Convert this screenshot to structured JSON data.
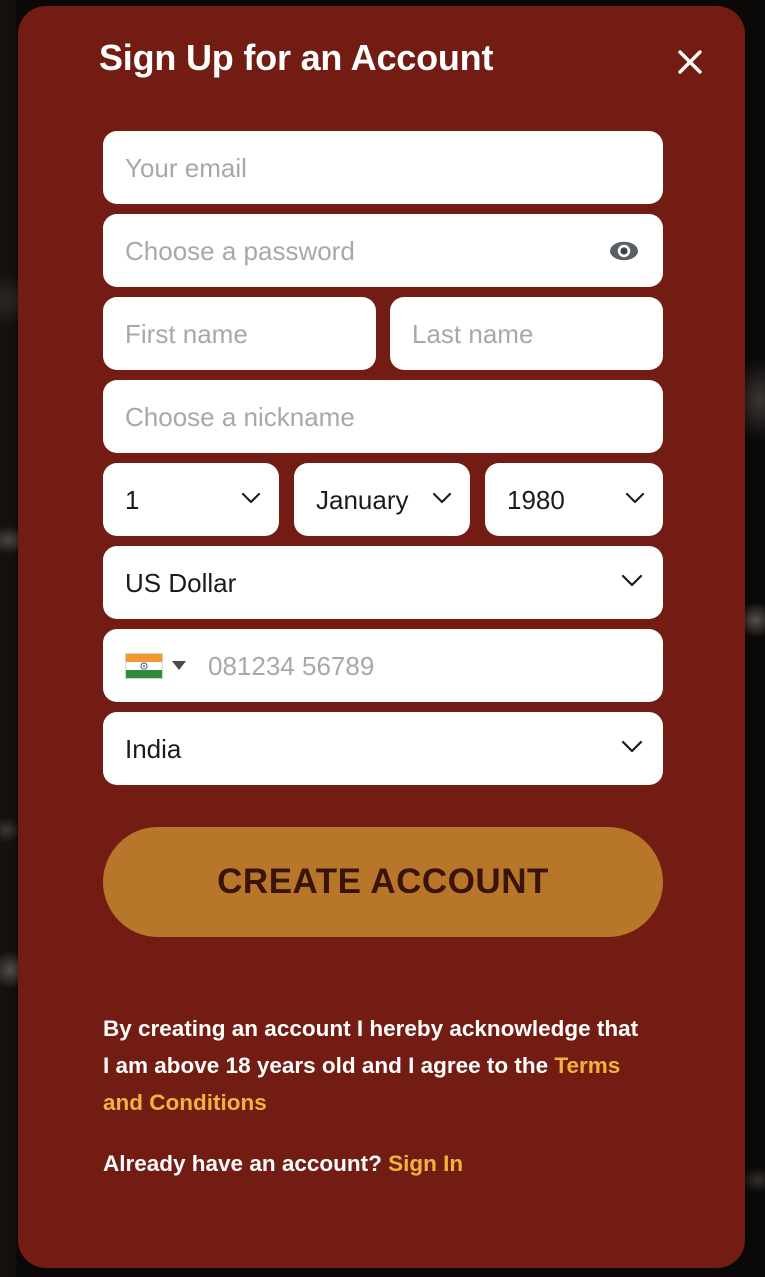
{
  "modal": {
    "title": "Sign Up for an Account",
    "close_icon": "close-icon",
    "background_color": "#731C13",
    "accent_gold": "#F2B33C",
    "button_color": "#B8762A"
  },
  "form": {
    "email": {
      "placeholder": "Your email",
      "value": ""
    },
    "password": {
      "placeholder": "Choose a password",
      "value": "",
      "toggle_icon": "eye-icon"
    },
    "first_name": {
      "placeholder": "First name",
      "value": ""
    },
    "last_name": {
      "placeholder": "Last name",
      "value": ""
    },
    "nickname": {
      "placeholder": "Choose a nickname",
      "value": ""
    },
    "birth_day": {
      "selected": "1"
    },
    "birth_month": {
      "selected": "January"
    },
    "birth_year": {
      "selected": "1980"
    },
    "currency": {
      "selected": "US Dollar"
    },
    "phone": {
      "placeholder": "081234 56789",
      "value": "",
      "country_flag": "india-flag-icon"
    },
    "country": {
      "selected": "India"
    }
  },
  "actions": {
    "create_account": "CREATE ACCOUNT"
  },
  "footer": {
    "legal_part1": "By creating an account I hereby acknowledge that I am above 18 years old and I agree to the ",
    "legal_link": "Terms and Conditions",
    "signin_prompt": "Already have an account? ",
    "signin_link": "Sign In"
  }
}
